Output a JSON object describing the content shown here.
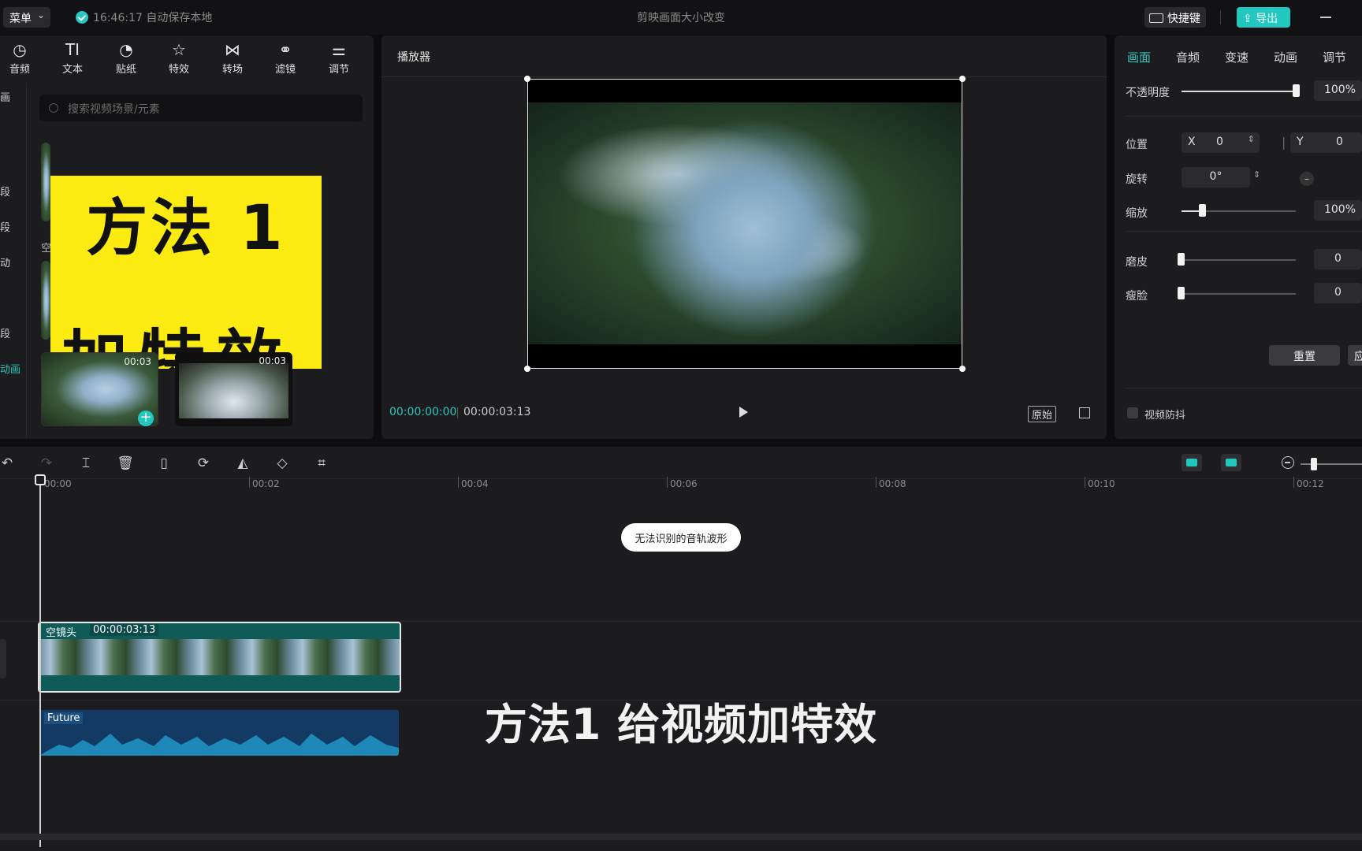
{
  "titlebar": {
    "menu_label": "菜单",
    "autosave_text": "16:46:17 自动保存本地",
    "doc_title": "剪映画面大小改变",
    "shortcut_label": "快捷键",
    "export_label": "导出"
  },
  "toolbar": {
    "items": [
      "音频",
      "文本",
      "贴纸",
      "特效",
      "转场",
      "滤镜",
      "调节"
    ]
  },
  "left_nav": {
    "items": [
      "画",
      "段",
      "段",
      "动",
      "段",
      "动画"
    ]
  },
  "media": {
    "search_placeholder": "搜索视频场景/元素",
    "section_label": "空",
    "preview_line1": "方法 1",
    "preview_line2": "加特效",
    "thumbs": [
      {
        "duration": "00:03"
      },
      {
        "duration": "00:03"
      }
    ]
  },
  "player": {
    "title": "播放器",
    "current_time": "00:00:00:00",
    "total_time": "00:00:03:13",
    "original_label": "原始"
  },
  "inspector": {
    "tabs": [
      "画面",
      "音频",
      "变速",
      "动画",
      "调节"
    ],
    "active_tab": "画面",
    "opacity_label": "不透明度",
    "opacity_value": "100%",
    "opacity_level": 1.0,
    "position_label": "位置",
    "x_label": "X",
    "x_value": "0",
    "y_label": "Y",
    "y_value": "0",
    "rotation_label": "旋转",
    "rotation_value": "0°",
    "scale_label": "缩放",
    "scale_value": "100%",
    "scale_level": 0.18,
    "smooth_label": "磨皮",
    "smooth_value": "0",
    "slim_label": "瘦脸",
    "slim_value": "0",
    "reset_label": "重置",
    "apply_label": "应",
    "stabilize_label": "视频防抖"
  },
  "timeline": {
    "ruler": [
      "00:00",
      "00:02",
      "00:04",
      "00:06",
      "00:08",
      "00:10",
      "00:12"
    ],
    "waveform_pill": "无法识别的音轨波形",
    "video_clip_name": "空镜头",
    "video_clip_duration": "00:00:03:13",
    "audio_clip_name": "Future",
    "subtitle": "方法1   给视频加特效"
  },
  "colors": {
    "accent": "#22c7c0",
    "preview_yellow": "#fbeb10",
    "video_clip": "#0e5b58",
    "audio_clip": "#123a63"
  }
}
